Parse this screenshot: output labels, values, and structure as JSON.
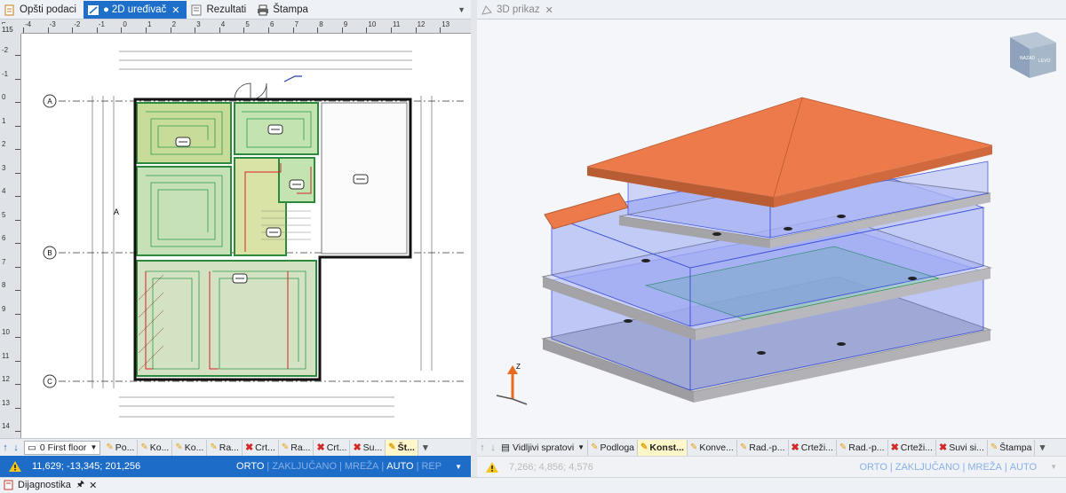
{
  "left_tabs": [
    {
      "label": "Opšti podaci",
      "active": false
    },
    {
      "label": "2D uređivač",
      "active": true
    },
    {
      "label": "Rezultati",
      "active": false
    },
    {
      "label": "Štampa",
      "active": false
    }
  ],
  "right_tab": {
    "label": "3D prikaz"
  },
  "ruler": {
    "corner_top": "115",
    "h_labels": [
      "-4",
      "-3",
      "-2",
      "-1",
      "0",
      "1",
      "2",
      "3",
      "4",
      "5",
      "6",
      "7",
      "8",
      "9",
      "10",
      "11",
      "12",
      "13"
    ],
    "v_labels": [
      "-2",
      "-1",
      "0",
      "1",
      "2",
      "3",
      "4",
      "5",
      "6",
      "7",
      "8",
      "9",
      "10",
      "11",
      "12",
      "13",
      "14"
    ]
  },
  "plan": {
    "axes": [
      "A",
      "B",
      "C"
    ],
    "room_label_a": "A"
  },
  "view3d": {
    "axis_z": "Z",
    "cube_faces": [
      "NAZAD",
      "LEVO"
    ]
  },
  "left_layer_bar": {
    "floor_select": "0 First floor",
    "items": [
      {
        "label": "Po...",
        "mark": "pin"
      },
      {
        "label": "Ko...",
        "mark": "pin"
      },
      {
        "label": "Ko...",
        "mark": "pin"
      },
      {
        "label": "Ra...",
        "mark": "pin"
      },
      {
        "label": "Crt...",
        "mark": "x"
      },
      {
        "label": "Ra...",
        "mark": "pin"
      },
      {
        "label": "Crt...",
        "mark": "x"
      },
      {
        "label": "Su...",
        "mark": "x"
      },
      {
        "label": "Št...",
        "mark": "pin",
        "active": true
      }
    ]
  },
  "right_layer_bar": {
    "visible_floors": "Vidljivi spratovi",
    "items": [
      {
        "label": "Podloga",
        "mark": "pin"
      },
      {
        "label": "Konst...",
        "mark": "pin",
        "active": true
      },
      {
        "label": "Konve...",
        "mark": "pin"
      },
      {
        "label": "Rad.-p...",
        "mark": "pin"
      },
      {
        "label": "Crteži...",
        "mark": "x"
      },
      {
        "label": "Rad.-p...",
        "mark": "pin"
      },
      {
        "label": "Crteži...",
        "mark": "x"
      },
      {
        "label": "Suvi si...",
        "mark": "x"
      },
      {
        "label": "Štampa",
        "mark": "pin"
      }
    ]
  },
  "left_status": {
    "coords": "11,629; -13,345; 201,256",
    "flags": [
      {
        "label": "ORTO",
        "on": true
      },
      {
        "label": "ZAKLJUČANO",
        "on": false
      },
      {
        "label": "MREŽA",
        "on": false
      },
      {
        "label": "AUTO",
        "on": true
      },
      {
        "label": "REP",
        "on": false
      }
    ]
  },
  "right_status": {
    "coords": "7,266; 4,856; 4,576",
    "flags": [
      {
        "label": "ORTO",
        "on": false
      },
      {
        "label": "ZAKLJUČANO",
        "on": false
      },
      {
        "label": "MREŽA",
        "on": false
      },
      {
        "label": "AUTO",
        "on": false
      }
    ]
  },
  "diagnostics": {
    "label": "Dijagnostika"
  },
  "colors": {
    "accent": "#1e6fc9",
    "roof": "#ec7a4a",
    "glass": "#5a6ff0",
    "slab": "#c8c8c8",
    "heating": "#3fae4f",
    "pipe_red": "#d4232b"
  }
}
